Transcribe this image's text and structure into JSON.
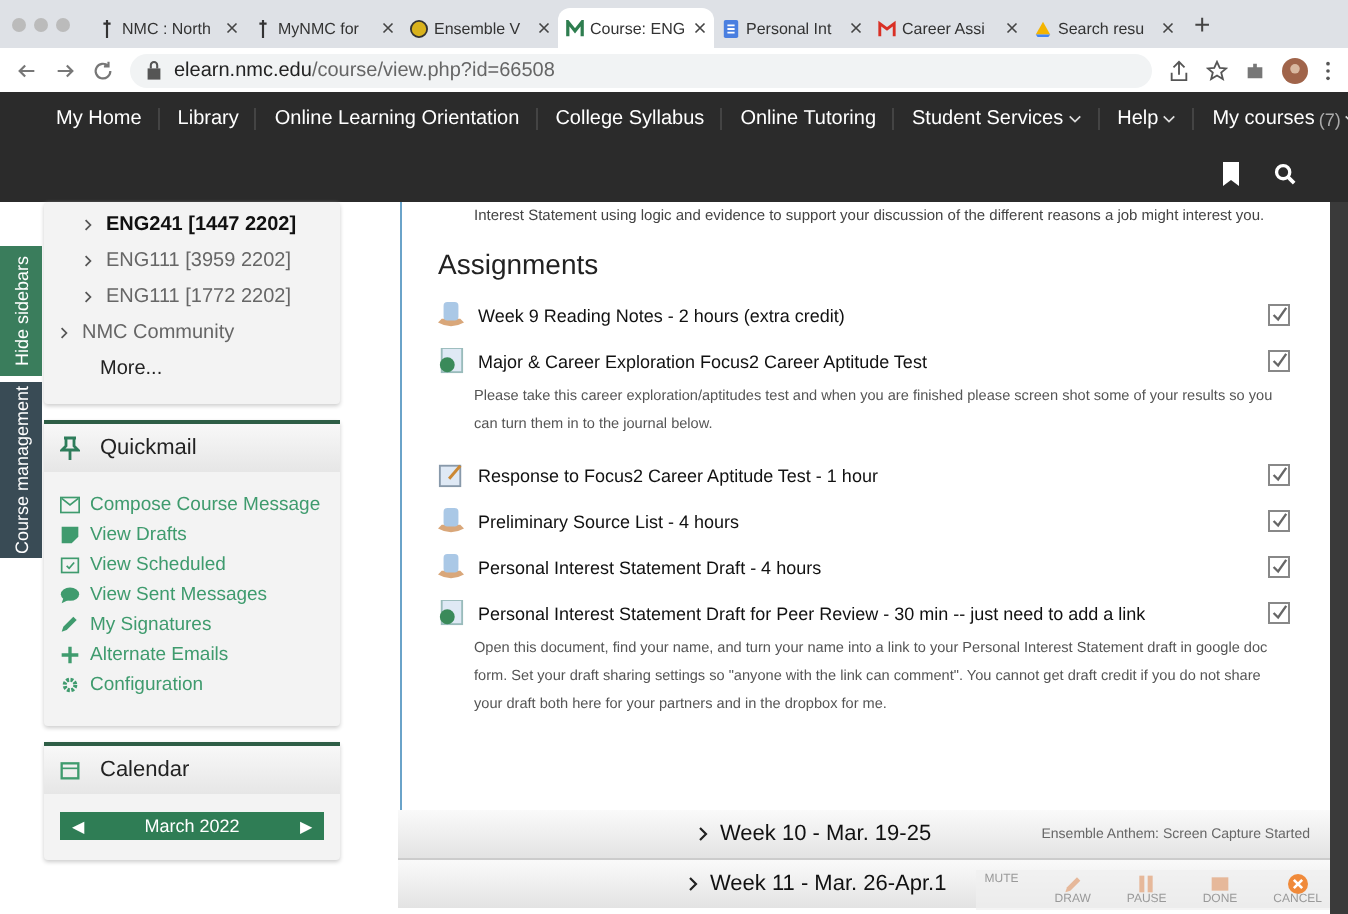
{
  "browser": {
    "tabs": [
      {
        "label": "NMC : North",
        "selected": false
      },
      {
        "label": "MyNMC for",
        "selected": false
      },
      {
        "label": "Ensemble V",
        "selected": false
      },
      {
        "label": "Course: ENG",
        "selected": true
      },
      {
        "label": "Personal Int",
        "selected": false
      },
      {
        "label": "Career Assi",
        "selected": false
      },
      {
        "label": "Search resu",
        "selected": false
      }
    ],
    "new_tab": "+",
    "url_host": "elearn.nmc.edu",
    "url_path": "/course/view.php?id=66508"
  },
  "nav": {
    "items": [
      {
        "label": "My Home",
        "dropdown": false
      },
      {
        "label": "Library",
        "dropdown": false
      },
      {
        "label": "Online Learning Orientation",
        "dropdown": false
      },
      {
        "label": "College Syllabus",
        "dropdown": false
      },
      {
        "label": "Online Tutoring",
        "dropdown": false
      },
      {
        "label": "Student Services",
        "dropdown": true
      },
      {
        "label": "Help",
        "dropdown": true
      },
      {
        "label": "My courses",
        "count": "(7)",
        "dropdown": true
      }
    ]
  },
  "side_tabs": [
    "Hide sidebars",
    "Course management"
  ],
  "courses": {
    "items": [
      {
        "label": "ENG241 [1447 2202]",
        "bold": true
      },
      {
        "label": "ENG111 [3959 2202]",
        "bold": false
      },
      {
        "label": "ENG111 [1772 2202]",
        "bold": false
      }
    ],
    "other": [
      {
        "label": "NMC Community",
        "bold": false
      }
    ],
    "more": "More..."
  },
  "quickmail": {
    "title": "Quickmail",
    "links": [
      "Compose Course Message",
      "View Drafts",
      "View Scheduled",
      "View Sent Messages",
      "My Signatures",
      "Alternate Emails",
      "Configuration"
    ]
  },
  "calendar": {
    "title": "Calendar",
    "month": "March 2022",
    "prev": "◀",
    "next": "▶"
  },
  "intro": "Interest Statement using logic and evidence to support your discussion of the different reasons a job might interest you.",
  "section_title": "Assignments",
  "assignments": [
    {
      "title": "Week 9 Reading Notes - 2 hours (extra credit)",
      "kind": "assignment",
      "completed": true
    },
    {
      "title": "Major & Career Exploration Focus2 Career Aptitude Test",
      "kind": "url",
      "completed": true,
      "description": "Please take this career exploration/aptitudes test and when you are finished please screen shot some of your results so you can turn them in to the journal below."
    },
    {
      "title": "Response to Focus2 Career Aptitude Test - 1 hour",
      "kind": "journal",
      "completed": true
    },
    {
      "title": "Preliminary Source List - 4 hours",
      "kind": "assignment",
      "completed": true
    },
    {
      "title": "Personal Interest Statement Draft - 4 hours",
      "kind": "assignment",
      "completed": true
    },
    {
      "title": "Personal Interest Statement Draft for Peer Review - 30 min -- just need to add a link",
      "kind": "url",
      "completed": true,
      "description": "Open this document, find your name, and turn your name into a link to your Personal Interest Statement draft in google doc form. Set your draft sharing settings so \"anyone with the link can comment\". You cannot get draft credit if you do not share your draft both here for your partners and in the dropbox for me."
    }
  ],
  "weeks": [
    "Week 10 - Mar. 19-25",
    "Week 11 - Mar. 26-Apr.1"
  ],
  "capture": {
    "message": "Ensemble Anthem: Screen Capture Started",
    "buttons": [
      {
        "label": "MUTE",
        "kind": "plain"
      },
      {
        "label": "DRAW",
        "kind": "draw"
      },
      {
        "label": "PAUSE",
        "kind": "pause"
      },
      {
        "label": "DONE",
        "kind": "done"
      },
      {
        "label": "CANCEL",
        "kind": "cancel"
      }
    ]
  }
}
